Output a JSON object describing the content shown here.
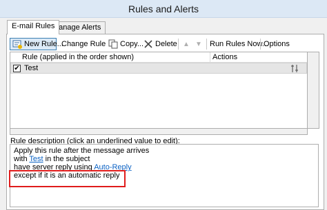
{
  "window": {
    "title": "Rules and Alerts"
  },
  "tabs": [
    {
      "label": "E-mail Rules"
    },
    {
      "label": "Manage Alerts"
    }
  ],
  "toolbar": {
    "new_rule": "New Rule...",
    "change_rule": "Change Rule",
    "copy": "Copy...",
    "delete": "Delete",
    "run_rules_now": "Run Rules Now...",
    "options": "Options"
  },
  "rules_table": {
    "columns": [
      "Rule (applied in the order shown)",
      "Actions"
    ],
    "rows": [
      {
        "name": "Test",
        "checked": true
      }
    ]
  },
  "description": {
    "label": "Rule description (click an underlined value to edit):",
    "line1": "Apply this rule after the message arrives",
    "line2_prefix": "with",
    "line2_link": "Test",
    "line2_suffix": "in the subject",
    "line3_prefix": "have server reply using",
    "line3_link": "Auto-Reply",
    "line4": "except if it is an automatic reply"
  },
  "colors": {
    "highlight": "#e01b1b",
    "link": "#0b62c4",
    "titlebar": "#dce8f5"
  }
}
